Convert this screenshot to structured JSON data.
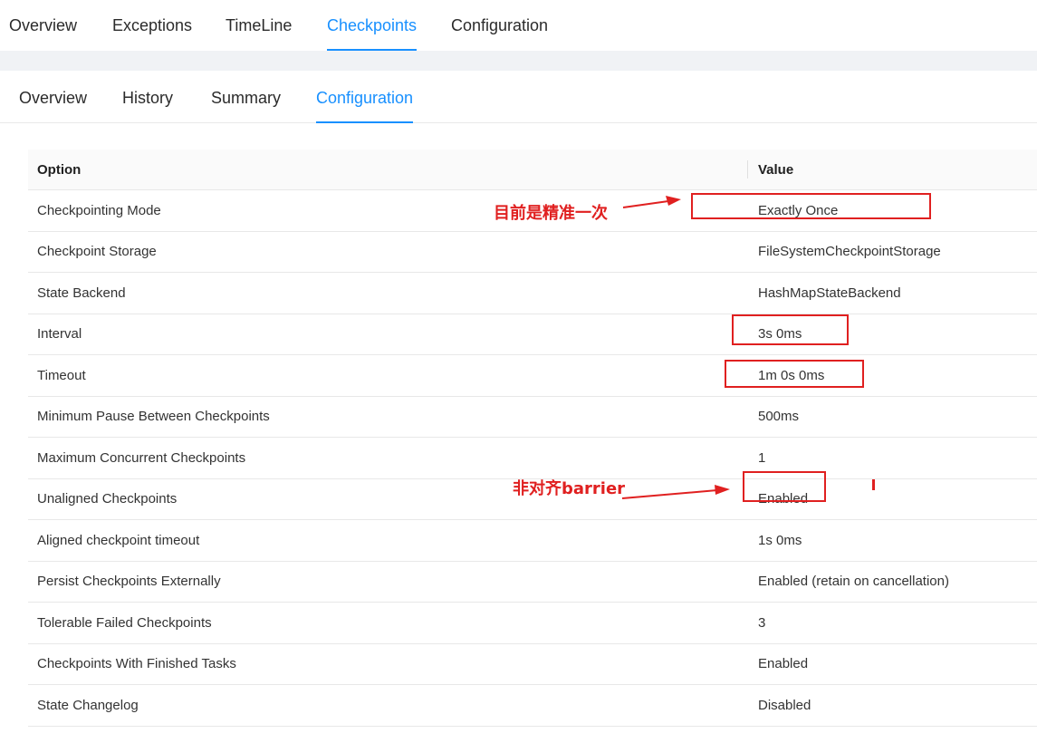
{
  "top_tabs": [
    {
      "label": "Overview",
      "active": false
    },
    {
      "label": "Exceptions",
      "active": false
    },
    {
      "label": "TimeLine",
      "active": false
    },
    {
      "label": "Checkpoints",
      "active": true
    },
    {
      "label": "Configuration",
      "active": false
    }
  ],
  "sub_tabs": [
    {
      "label": "Overview",
      "active": false
    },
    {
      "label": "History",
      "active": false
    },
    {
      "label": "Summary",
      "active": false
    },
    {
      "label": "Configuration",
      "active": true
    }
  ],
  "table": {
    "headers": {
      "option": "Option",
      "value": "Value"
    },
    "rows": [
      {
        "option": "Checkpointing Mode",
        "value": "Exactly Once"
      },
      {
        "option": "Checkpoint Storage",
        "value": "FileSystemCheckpointStorage"
      },
      {
        "option": "State Backend",
        "value": "HashMapStateBackend"
      },
      {
        "option": "Interval",
        "value": "3s 0ms"
      },
      {
        "option": "Timeout",
        "value": "1m 0s 0ms"
      },
      {
        "option": "Minimum Pause Between Checkpoints",
        "value": "500ms"
      },
      {
        "option": "Maximum Concurrent Checkpoints",
        "value": "1"
      },
      {
        "option": "Unaligned Checkpoints",
        "value": "Enabled"
      },
      {
        "option": "Aligned checkpoint timeout",
        "value": "1s 0ms"
      },
      {
        "option": "Persist Checkpoints Externally",
        "value": "Enabled (retain on cancellation)"
      },
      {
        "option": "Tolerable Failed Checkpoints",
        "value": "3"
      },
      {
        "option": "Checkpoints With Finished Tasks",
        "value": "Enabled"
      },
      {
        "option": "State Changelog",
        "value": "Disabled"
      }
    ]
  },
  "annotations": {
    "mode_note": "目前是精准一次",
    "unaligned_note": "非对齐barrier",
    "color": "#e02020"
  },
  "colors": {
    "accent": "#1890ff",
    "band": "#f0f2f5"
  }
}
